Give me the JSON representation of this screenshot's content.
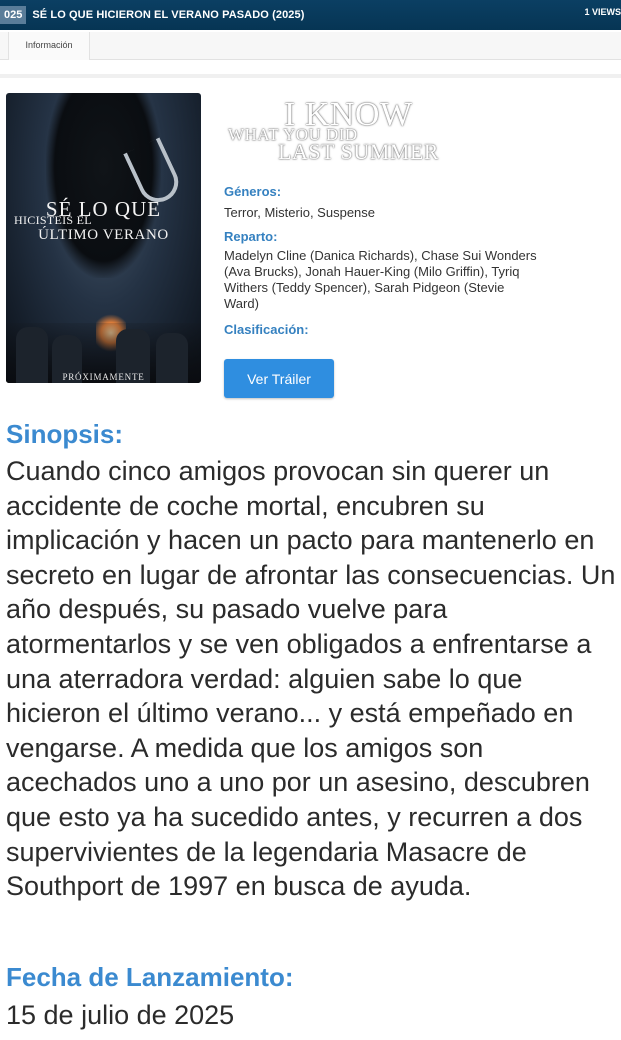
{
  "header": {
    "year_badge": "025",
    "title": "SÉ LO QUE HICIERON EL VERANO PASADO (2025)",
    "views": "1 VIEWS"
  },
  "tabs": [
    {
      "label": "Información"
    }
  ],
  "poster": {
    "title_line1": "SÉ LO QUE",
    "title_line2": "HICISTEIS EL",
    "title_line3": "ÚLTIMO VERANO",
    "bottom_text": "PRÓXIMAMENTE"
  },
  "logo": {
    "line1": "I KNOW",
    "line2": "WHAT YOU DID",
    "line3": "LAST SUMMER"
  },
  "details": {
    "generos_label": "Géneros:",
    "generos_value": "Terror, Misterio, Suspense",
    "reparto_label": "Reparto:",
    "reparto_value": "Madelyn Cline (Danica Richards), Chase Sui Wonders (Ava Brucks), Jonah Hauer-King (Milo Griffin), Tyriq Withers (Teddy Spencer), Sarah Pidgeon (Stevie Ward)",
    "clasificacion_label": "Clasificación:"
  },
  "trailer_button": "Ver Tráiler",
  "sinopsis": {
    "label": "Sinopsis:",
    "text": "Cuando cinco amigos provocan sin querer un accidente de coche mortal, encubren su implicación y hacen un pacto para mantenerlo en secreto en lugar de afrontar las consecuencias. Un año después, su pasado vuelve para atormentarlos y se ven obligados a enfrentarse a una aterradora verdad: alguien sabe lo que hicieron el último verano... y está empeñado en vengarse. A medida que los amigos son acechados uno a uno por un asesino, descubren que esto ya ha sucedido antes, y recurren a dos supervivientes de la legendaria Masacre de Southport de 1997 en busca de ayuda."
  },
  "release": {
    "label": "Fecha de Lanzamiento:",
    "value": "15 de julio de 2025"
  },
  "colors": {
    "header_bg": "#063554",
    "accent_blue": "#3b8ad0",
    "button_blue": "#2f8ee0"
  }
}
